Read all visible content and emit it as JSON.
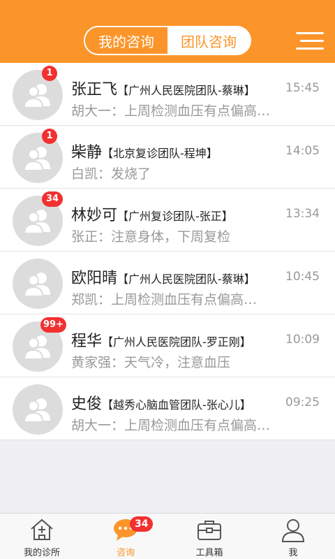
{
  "header": {
    "segments": [
      "我的咨询",
      "团队咨询"
    ],
    "selected": "我的咨询",
    "menu_icon": "menu-lines-icon"
  },
  "colors": {
    "accent": "#fb952a",
    "badge": "#f23030"
  },
  "conversations": [
    {
      "name": "张正飞",
      "team": "【广州人民医院团队-蔡琳】",
      "time": "15:45",
      "message": "胡大一：上周检测血压有点偏高…",
      "badge": "1"
    },
    {
      "name": "柴静",
      "team": "【北京复诊团队-程坤】",
      "time": "14:05",
      "message": "白凯：发烧了",
      "badge": "1"
    },
    {
      "name": "林妙可",
      "team": "【广州复诊团队-张正】",
      "time": "13:34",
      "message": "张正：注意身体，下周复检",
      "badge": "34"
    },
    {
      "name": "欧阳晴",
      "team": "【广州人民医院团队-蔡琳】",
      "time": "10:45",
      "message": "郑凯：上周检测血压有点偏高…",
      "badge": ""
    },
    {
      "name": "程华",
      "team": "【广州人民医院团队-罗正刚】",
      "time": "10:09",
      "message": "黄家强：天气冷，注意血压",
      "badge": "99+"
    },
    {
      "name": "史俊",
      "team": "【越秀心脑血管团队-张心儿】",
      "time": "09:25",
      "message": "胡大一：上周检测血压有点偏高…",
      "badge": ""
    }
  ],
  "tabbar": {
    "tabs": [
      {
        "label": "我的诊所",
        "icon": "clinic-house-icon"
      },
      {
        "label": "咨询",
        "icon": "chat-bubble-icon",
        "badge": "34"
      },
      {
        "label": "工具箱",
        "icon": "toolbox-icon"
      },
      {
        "label": "我",
        "icon": "person-icon"
      }
    ],
    "active": "咨询"
  }
}
